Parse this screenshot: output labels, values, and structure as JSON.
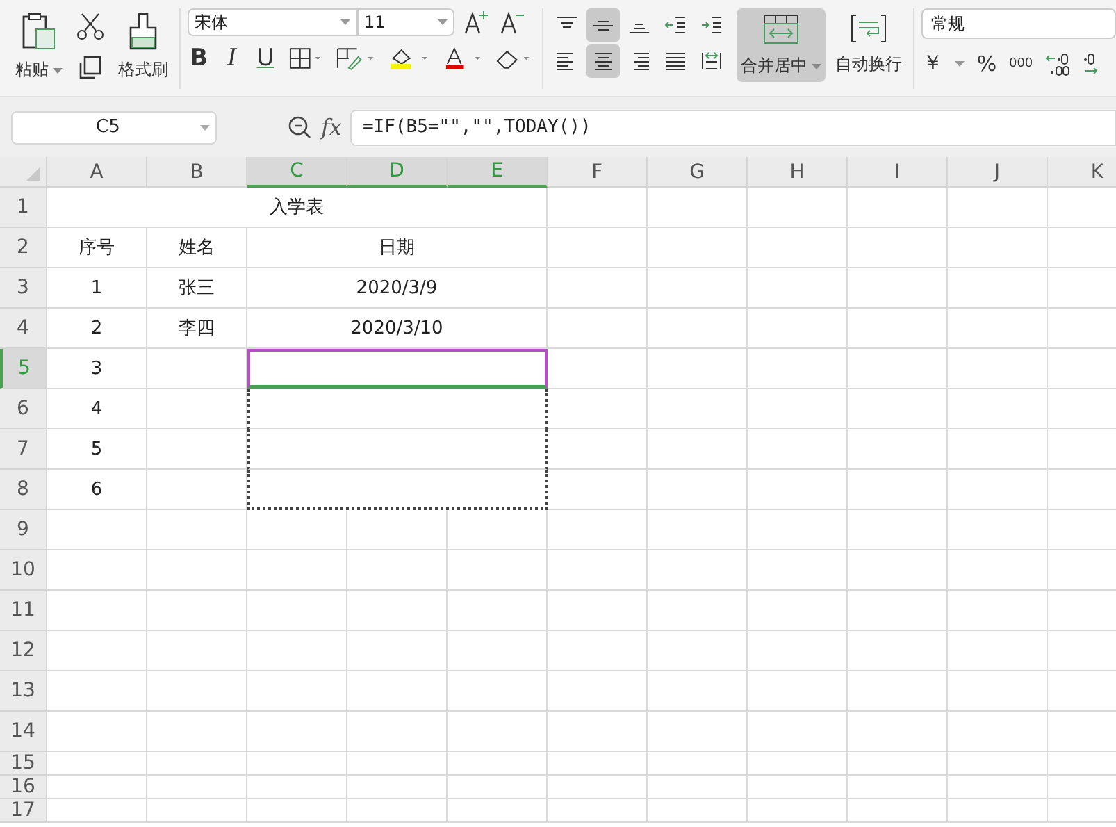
{
  "ribbon": {
    "paste": {
      "label": "粘贴"
    },
    "painter": {
      "label": "格式刷"
    },
    "font": {
      "family": "宋体",
      "size": "11"
    },
    "text_styles": [
      {
        "kind": "bold",
        "label": "B"
      },
      {
        "kind": "italic",
        "label": "I"
      },
      {
        "kind": "underline",
        "label": "U"
      }
    ],
    "align_buttons": [
      {
        "kind": "top",
        "selected": false
      },
      {
        "kind": "middle",
        "selected": true
      },
      {
        "kind": "bottom",
        "selected": false
      },
      {
        "kind": "outdent",
        "selected": false
      },
      {
        "kind": "indent",
        "selected": false
      },
      {
        "kind": "left",
        "selected": false
      },
      {
        "kind": "center",
        "selected": true
      },
      {
        "kind": "right",
        "selected": false
      },
      {
        "kind": "justify",
        "selected": false
      },
      {
        "kind": "distributed",
        "selected": false
      }
    ],
    "merge": {
      "label": "合并居中",
      "selected": true
    },
    "wrap": {
      "label": "自动换行"
    },
    "number": {
      "format": "常规",
      "currency": "￥",
      "percent": "%",
      "thousands": "000"
    }
  },
  "formula_bar": {
    "name_box": "C5",
    "fx": "fx",
    "formula": "=IF(B5=\"\",\"\",TODAY())"
  },
  "sheet": {
    "columns": [
      {
        "label": "A",
        "selected": false
      },
      {
        "label": "B",
        "selected": false
      },
      {
        "label": "C",
        "selected": true
      },
      {
        "label": "D",
        "selected": true
      },
      {
        "label": "E",
        "selected": true
      },
      {
        "label": "F",
        "selected": false
      },
      {
        "label": "G",
        "selected": false
      },
      {
        "label": "H",
        "selected": false
      },
      {
        "label": "I",
        "selected": false
      },
      {
        "label": "J",
        "selected": false
      },
      {
        "label": "K",
        "selected": false
      }
    ],
    "rows": [
      {
        "number": "1",
        "selected": false,
        "cells": [
          {
            "kind": "cell",
            "text": "入学表"
          },
          {
            "kind": "merged"
          },
          {
            "kind": "merged"
          },
          {
            "kind": "merged"
          },
          {
            "kind": "merged"
          }
        ]
      },
      {
        "number": "2",
        "selected": false,
        "cells": [
          {
            "kind": "cell",
            "text": "序号"
          },
          {
            "kind": "cell",
            "text": "姓名"
          },
          {
            "kind": "cell",
            "text": "日期"
          },
          {
            "kind": "merged"
          },
          {
            "kind": "merged"
          }
        ]
      },
      {
        "number": "3",
        "selected": false,
        "cells": [
          {
            "kind": "cell",
            "text": "1"
          },
          {
            "kind": "cell",
            "text": "张三"
          },
          {
            "kind": "cell",
            "text": "2020/3/9"
          },
          {
            "kind": "merged"
          },
          {
            "kind": "merged"
          }
        ]
      },
      {
        "number": "4",
        "selected": false,
        "cells": [
          {
            "kind": "cell",
            "text": "2"
          },
          {
            "kind": "cell",
            "text": "李四"
          },
          {
            "kind": "cell",
            "text": "2020/3/10"
          },
          {
            "kind": "merged"
          },
          {
            "kind": "merged"
          }
        ]
      },
      {
        "number": "5",
        "selected": true,
        "cells": [
          {
            "kind": "cell",
            "text": "3"
          },
          {
            "kind": "cell"
          },
          {
            "kind": "cell",
            "selected": true
          },
          {
            "kind": "merged"
          },
          {
            "kind": "merged"
          }
        ]
      },
      {
        "number": "6",
        "selected": false,
        "cells": [
          {
            "kind": "cell",
            "text": "4"
          },
          {
            "kind": "cell"
          },
          {
            "kind": "cell",
            "copied": true
          },
          {
            "kind": "merged"
          },
          {
            "kind": "merged"
          }
        ]
      },
      {
        "number": "7",
        "selected": false,
        "cells": [
          {
            "kind": "cell",
            "text": "5"
          },
          {
            "kind": "cell"
          },
          {
            "kind": "cell",
            "copied": true
          },
          {
            "kind": "merged"
          },
          {
            "kind": "merged"
          }
        ]
      },
      {
        "number": "8",
        "selected": false,
        "cells": [
          {
            "kind": "cell",
            "text": "6"
          },
          {
            "kind": "cell"
          },
          {
            "kind": "cell",
            "copied": true
          },
          {
            "kind": "merged"
          },
          {
            "kind": "merged"
          }
        ]
      },
      {
        "number": "9",
        "selected": false,
        "cells": []
      },
      {
        "number": "10",
        "selected": false,
        "cells": []
      },
      {
        "number": "11",
        "selected": false,
        "cells": []
      },
      {
        "number": "12",
        "selected": false,
        "cells": []
      },
      {
        "number": "13",
        "selected": false,
        "cells": []
      },
      {
        "number": "14",
        "selected": false,
        "cells": []
      },
      {
        "number": "15",
        "selected": false,
        "cells": []
      },
      {
        "number": "16",
        "selected": false,
        "cells": []
      },
      {
        "number": "17",
        "selected": false,
        "cells": []
      }
    ]
  }
}
